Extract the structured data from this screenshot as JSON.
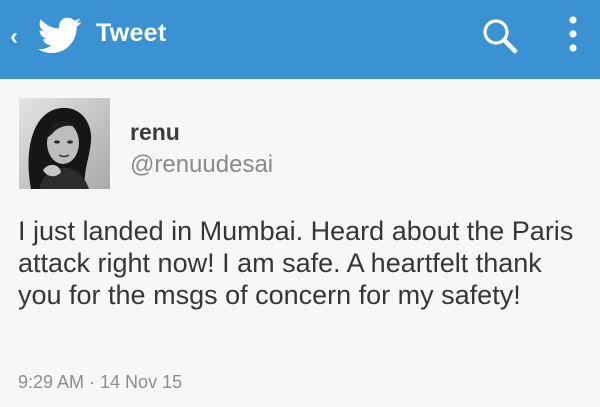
{
  "appbar": {
    "title": "Tweet",
    "back_icon": "chevron-left-icon",
    "logo_icon": "twitter-bird-icon",
    "search_icon": "search-icon",
    "menu_icon": "overflow-menu-icon",
    "color": "#3a92d2"
  },
  "tweet": {
    "author": {
      "name": "renu",
      "handle": "@renuudesai",
      "avatar_icon": "profile-photo"
    },
    "text": "I just landed in Mumbai. Heard about the Paris attack right now! I am safe. A heartfelt thank you for the msgs of concern for my safety!",
    "timestamp": "9:29 AM · 14 Nov 15"
  }
}
